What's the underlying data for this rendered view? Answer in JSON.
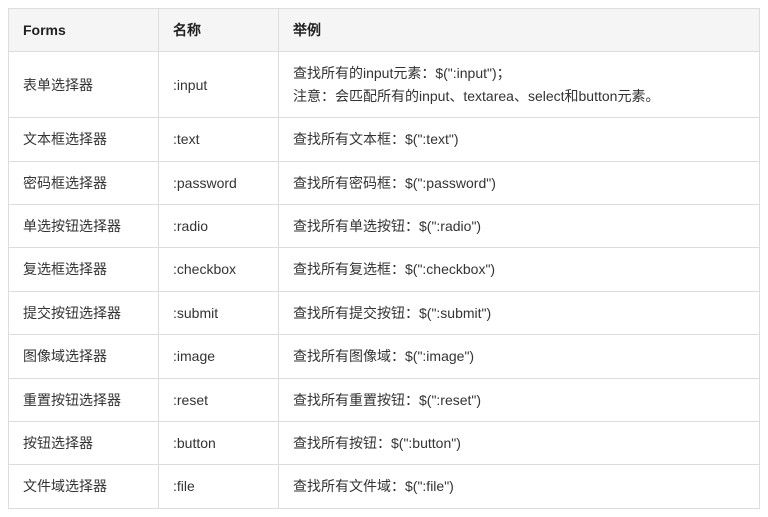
{
  "table": {
    "headers": [
      "Forms",
      "名称",
      "举例"
    ],
    "rows": [
      {
        "forms": "表单选择器",
        "name": ":input",
        "example": "查找所有的input元素：$(\":input\")；\n注意：会匹配所有的input、textarea、select和button元素。"
      },
      {
        "forms": "文本框选择器",
        "name": ":text",
        "example": "查找所有文本框：$(\":text\")"
      },
      {
        "forms": "密码框选择器",
        "name": ":password",
        "example": "查找所有密码框：$(\":password\")"
      },
      {
        "forms": "单选按钮选择器",
        "name": ":radio",
        "example": "查找所有单选按钮：$(\":radio\")"
      },
      {
        "forms": "复选框选择器",
        "name": ":checkbox",
        "example": "查找所有复选框：$(\":checkbox\")"
      },
      {
        "forms": "提交按钮选择器",
        "name": ":submit",
        "example": "查找所有提交按钮：$(\":submit\")"
      },
      {
        "forms": "图像域选择器",
        "name": ":image",
        "example": "查找所有图像域：$(\":image\")"
      },
      {
        "forms": "重置按钮选择器",
        "name": ":reset",
        "example": "查找所有重置按钮：$(\":reset\")"
      },
      {
        "forms": "按钮选择器",
        "name": ":button",
        "example": "查找所有按钮：$(\":button\")"
      },
      {
        "forms": "文件域选择器",
        "name": ":file",
        "example": "查找所有文件域：$(\":file\")"
      }
    ]
  }
}
